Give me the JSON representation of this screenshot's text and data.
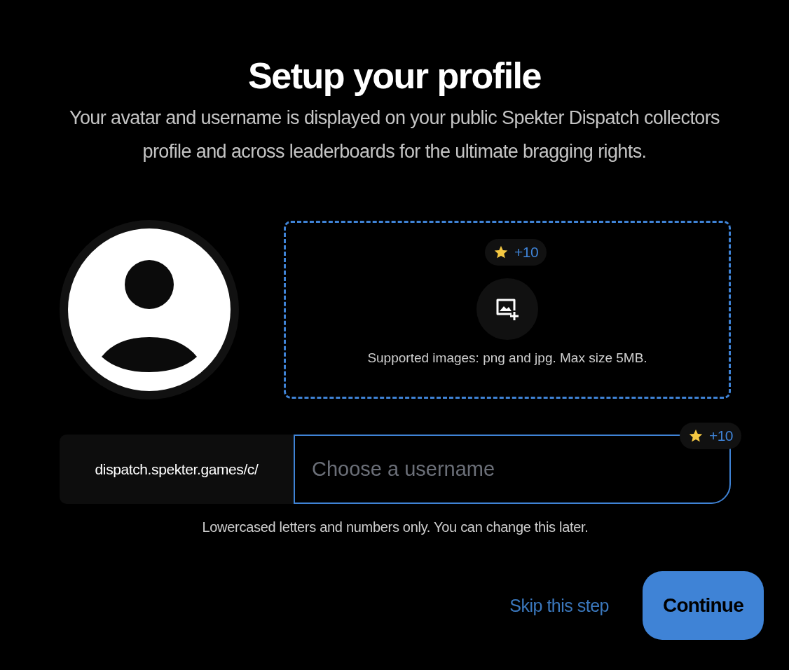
{
  "title": "Setup your profile",
  "subtitle": "Your avatar and username is displayed on your public Spekter Dispatch collectors profile and across leaderboards for the ultimate bragging rights.",
  "upload": {
    "badge": "+10",
    "hint": "Supported images: png and jpg. Max size 5MB."
  },
  "username": {
    "prefix": "dispatch.spekter.games/c/",
    "placeholder": "Choose a username",
    "badge": "+10",
    "hint": "Lowercased letters and numbers only. You can change this later."
  },
  "buttons": {
    "skip": "Skip this step",
    "continue": "Continue"
  }
}
